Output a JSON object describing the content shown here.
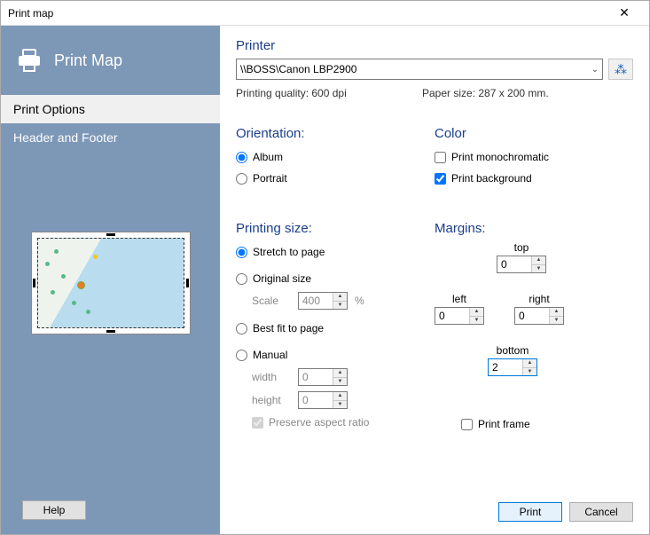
{
  "window": {
    "title": "Print map"
  },
  "sidebar": {
    "header": "Print Map",
    "items": [
      "Print Options",
      "Header and Footer"
    ],
    "help": "Help"
  },
  "printer": {
    "heading": "Printer",
    "selected": "\\\\BOSS\\Canon LBP2900",
    "quality_label": "Printing quality: 600 dpi",
    "paper_label": "Paper size: 287 x 200 mm."
  },
  "orientation": {
    "heading": "Orientation:",
    "album": "Album",
    "portrait": "Portrait",
    "selected": "album"
  },
  "color": {
    "heading": "Color",
    "mono": "Print monochromatic",
    "bg": "Print background",
    "mono_checked": false,
    "bg_checked": true
  },
  "printing_size": {
    "heading": "Printing size:",
    "stretch": "Stretch to page",
    "original": "Original size",
    "scale_label": "Scale",
    "scale_value": "400",
    "scale_unit": "%",
    "best_fit": "Best fit to page",
    "manual": "Manual",
    "width_label": "width",
    "width_value": "0",
    "height_label": "height",
    "height_value": "0",
    "preserve": "Preserve aspect ratio",
    "selected": "stretch"
  },
  "margins": {
    "heading": "Margins:",
    "top_label": "top",
    "top": "0",
    "left_label": "left",
    "left": "0",
    "right_label": "right",
    "right": "0",
    "bottom_label": "bottom",
    "bottom": "2",
    "frame": "Print frame",
    "frame_checked": false
  },
  "footer": {
    "print": "Print",
    "cancel": "Cancel"
  }
}
